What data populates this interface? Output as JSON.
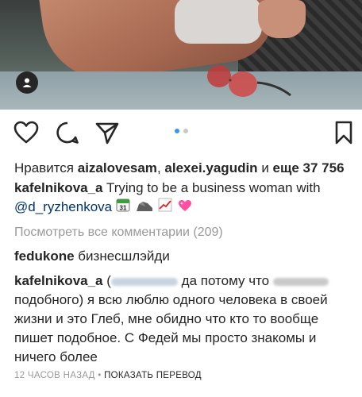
{
  "post": {
    "likes_prefix": "Нравится",
    "liker_1": "aizalovesam",
    "separator": ",",
    "liker_2": "alexei.yagudin",
    "likes_and_more": "и",
    "likes_count": "еще 37 756",
    "author": "kafelnikova_a",
    "caption_text": "Trying to be a business woman with",
    "caption_mention": "@d_ryzhenkova",
    "calendar_day": "31",
    "view_all_comments": "Посмотреть все комментарии (209)",
    "comments": [
      {
        "user": "fedukone",
        "text": "бизнесшлэйди"
      },
      {
        "user": "kafelnikova_a",
        "text_open": "(",
        "text_part1": "да потому что",
        "text_part2": "подобного) я всю люблю одного человека в своей жизни и это Глеб, мне обидно что кто то вообще пишет подобное. С Федей мы просто знакомы и ничего более"
      }
    ],
    "timestamp": "12 ЧАСОВ НАЗАД",
    "dot_separator": "•",
    "translate": "ПОКАЗАТЬ ПЕРЕВОД"
  },
  "carousel": {
    "total": 2,
    "active": 0
  },
  "colors": {
    "accent": "#3897f0",
    "mention": "#003569",
    "muted": "#999999",
    "text": "#262626"
  },
  "icons": [
    "user-tag-icon",
    "heart-icon",
    "comment-icon",
    "share-icon",
    "bookmark-icon"
  ]
}
